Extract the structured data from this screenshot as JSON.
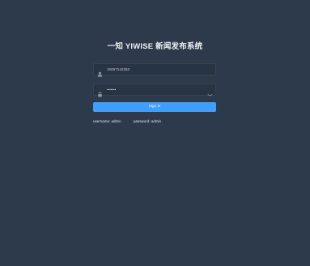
{
  "title": "一知 YIWISE 新闻发布系统",
  "login": {
    "username_value": "15067142353",
    "password_value": "•••••••",
    "signin_label": "Sign in"
  },
  "tips": {
    "username": "username: admin",
    "password": "password: admin"
  },
  "icons": {
    "username": "user-icon",
    "password": "lock-icon",
    "toggle": "eye-icon"
  },
  "colors": {
    "background": "#2d3a4b",
    "input_background": "#283443",
    "accent": "#409eff"
  }
}
